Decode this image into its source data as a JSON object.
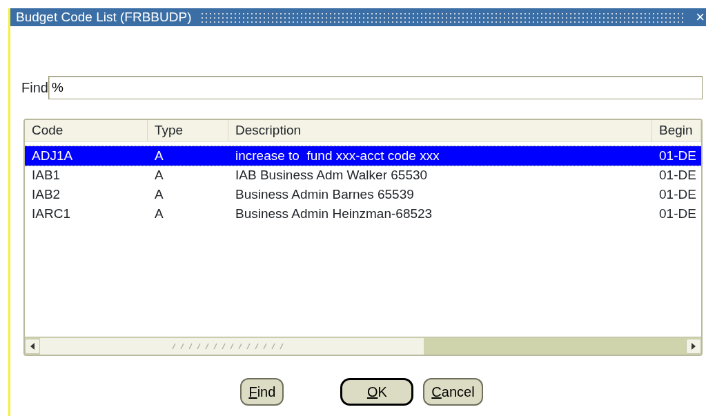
{
  "window": {
    "title": "Budget Code List (FRBBUDP)",
    "close": "×"
  },
  "find": {
    "label": "Find",
    "value": "%"
  },
  "table": {
    "columns": [
      "Code",
      "Type",
      "Description",
      "Begin"
    ],
    "rows": [
      {
        "cells": [
          "ADJ1A",
          "A",
          "increase to  fund xxx-acct code xxx",
          "01-DE"
        ],
        "selected": true
      },
      {
        "cells": [
          "IAB1",
          "A",
          "IAB Business Adm Walker 65530",
          "01-DE"
        ],
        "selected": false
      },
      {
        "cells": [
          "IAB2",
          "A",
          "Business Admin Barnes 65539",
          "01-DE"
        ],
        "selected": false
      },
      {
        "cells": [
          "IARC1",
          "A",
          "Business Admin Heinzman-68523",
          "01-DE"
        ],
        "selected": false
      }
    ]
  },
  "buttons": [
    {
      "label": "Find",
      "default": false
    },
    {
      "label": "OK",
      "default": true
    },
    {
      "label": "Cancel",
      "default": false
    }
  ]
}
